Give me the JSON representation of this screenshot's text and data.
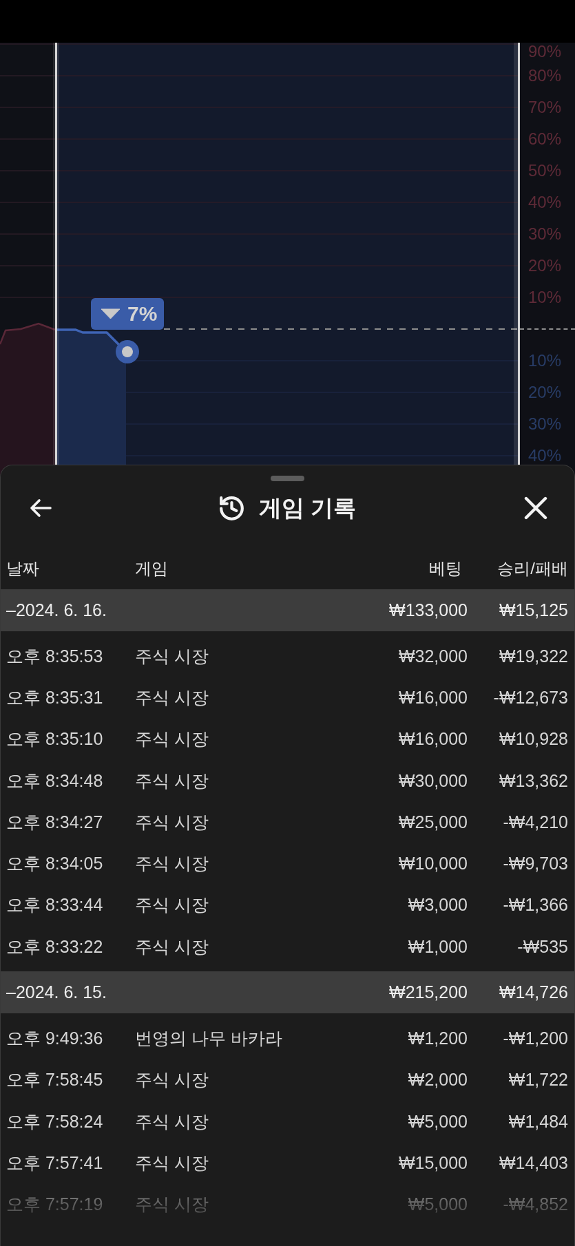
{
  "chart": {
    "upper_ticks": [
      "90%",
      "80%",
      "70%",
      "60%",
      "50%",
      "40%",
      "30%",
      "20%",
      "10%"
    ],
    "lower_ticks": [
      "10%",
      "20%",
      "30%",
      "40%"
    ],
    "badge": {
      "text": "7%",
      "falling": true
    }
  },
  "sheet": {
    "title": "게임 기록",
    "columns": [
      "날짜",
      "게임",
      "베팅",
      "승리/패배"
    ],
    "groups": [
      {
        "date": "–2024. 6. 16.",
        "bet": "₩133,000",
        "result": "₩15,125",
        "rows": [
          {
            "time": "오후 8:35:53",
            "game": "주식 시장",
            "bet": "₩32,000",
            "result": "₩19,322"
          },
          {
            "time": "오후 8:35:31",
            "game": "주식 시장",
            "bet": "₩16,000",
            "result": "-₩12,673"
          },
          {
            "time": "오후 8:35:10",
            "game": "주식 시장",
            "bet": "₩16,000",
            "result": "₩10,928"
          },
          {
            "time": "오후 8:34:48",
            "game": "주식 시장",
            "bet": "₩30,000",
            "result": "₩13,362"
          },
          {
            "time": "오후 8:34:27",
            "game": "주식 시장",
            "bet": "₩25,000",
            "result": "-₩4,210"
          },
          {
            "time": "오후 8:34:05",
            "game": "주식 시장",
            "bet": "₩10,000",
            "result": "-₩9,703"
          },
          {
            "time": "오후 8:33:44",
            "game": "주식 시장",
            "bet": "₩3,000",
            "result": "-₩1,366"
          },
          {
            "time": "오후 8:33:22",
            "game": "주식 시장",
            "bet": "₩1,000",
            "result": "-₩535"
          }
        ]
      },
      {
        "date": "–2024. 6. 15.",
        "bet": "₩215,200",
        "result": "₩14,726",
        "rows": [
          {
            "time": "오후 9:49:36",
            "game": "번영의 나무 바카라",
            "bet": "₩1,200",
            "result": "-₩1,200"
          },
          {
            "time": "오후 7:58:45",
            "game": "주식 시장",
            "bet": "₩2,000",
            "result": "₩1,722"
          },
          {
            "time": "오후 7:58:24",
            "game": "주식 시장",
            "bet": "₩5,000",
            "result": "₩1,484"
          },
          {
            "time": "오후 7:57:41",
            "game": "주식 시장",
            "bet": "₩15,000",
            "result": "₩14,403"
          },
          {
            "time": "오후 7:57:19",
            "game": "주식 시장",
            "bet": "₩5,000",
            "result": "-₩4,852"
          }
        ]
      }
    ]
  }
}
